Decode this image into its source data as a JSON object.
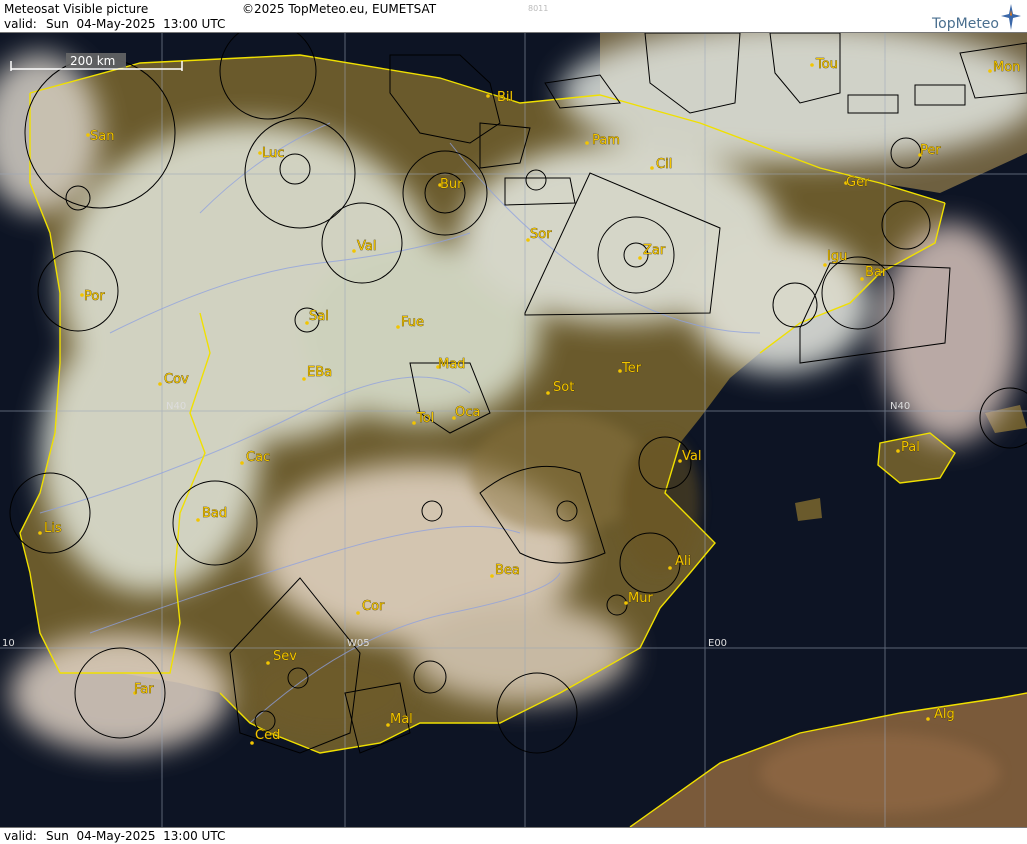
{
  "header": {
    "title": "Meteosat Visible picture",
    "copyright": "©2025 TopMeteo.eu, EUMETSAT",
    "code": "8011",
    "valid_label": "valid:",
    "valid_date": "Sun  04-May-2025  13:00 UTC",
    "brand": "TopMeteo"
  },
  "footer": {
    "valid_label": "valid:",
    "valid_date": "Sun  04-May-2025  13:00 UTC"
  },
  "scale": {
    "label": "200 km"
  },
  "grid_labels": {
    "n40_west": "N40",
    "n40_east": "N40",
    "e00": "E00",
    "w05": "W05",
    "w10": "10"
  },
  "cities": {
    "san": "San",
    "luc": "Luc",
    "bil": "Bil",
    "tou": "Tou",
    "mon": "Mon",
    "pam": "Pam",
    "per": "Per",
    "cil": "Cil",
    "bur": "Bur",
    "ger": "Ger",
    "val_north": "Val",
    "sor": "Sor",
    "zar": "Zar",
    "igu": "Igu",
    "bar": "Bar",
    "por": "Por",
    "sal": "Sal",
    "fue": "Fue",
    "mad": "Mad",
    "ter": "Ter",
    "cov": "Cov",
    "eba": "EBa",
    "sot": "Sot",
    "tol": "Tol",
    "oca": "Oca",
    "pal": "Pal",
    "cac": "Cac",
    "val_east": "Val",
    "lis": "Lis",
    "bad": "Bad",
    "ali": "Ali",
    "bea": "Bea",
    "mur": "Mur",
    "cor": "Cor",
    "sev": "Sev",
    "far": "Far",
    "mal": "Mal",
    "ced": "Ced",
    "alg": "Alg"
  },
  "colors": {
    "sea": "#0d1424",
    "land": "#6a5a2c",
    "cloud": "#e4e8dc",
    "border": "#f0e000",
    "city": "#f2c500",
    "grid": "#9aa6b8",
    "airspace": "#000000"
  }
}
